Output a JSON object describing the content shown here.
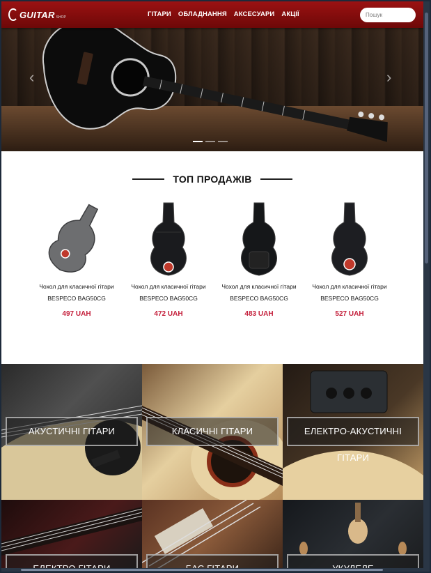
{
  "logo": {
    "text": "GUITAR",
    "sub": "SHOP"
  },
  "nav": {
    "items": [
      {
        "label": "ГІТАРИ"
      },
      {
        "label": "ОБЛАДНАННЯ"
      },
      {
        "label": "АКСЕСУАРИ"
      },
      {
        "label": "АКЦІЇ"
      }
    ]
  },
  "search": {
    "placeholder": "Пошук"
  },
  "hero": {
    "prev_icon": "chevron-left-icon",
    "next_icon": "chevron-right-icon",
    "slides": 3,
    "active_slide": 1
  },
  "top_sales": {
    "title": "ТОП ПРОДАЖІВ",
    "products": [
      {
        "name_line1": "Чохол для класичної гітари",
        "name_line2": "BESPECO BAG50CG",
        "price": "497 UAH",
        "color": "#6d6e70"
      },
      {
        "name_line1": "Чохол для класичної гітари",
        "name_line2": "BESPECO BAG50CG",
        "price": "472 UAH",
        "color": "#1a1b1e"
      },
      {
        "name_line1": "Чохол для класичної гітари",
        "name_line2": "BESPECO BAG50CG",
        "price": "483 UAH",
        "color": "#151719"
      },
      {
        "name_line1": "Чохол для класичної гітари",
        "name_line2": "BESPECO BAG50CG",
        "price": "527 UAH",
        "color": "#1d1e22"
      }
    ]
  },
  "categories": [
    {
      "label": "АКУСТИЧНІ ГІТАРИ"
    },
    {
      "label": "КЛАСИЧНІ ГІТАРИ"
    },
    {
      "label": "ЕЛЕКТРО-АКУСТИЧНІ ГІТАРИ"
    },
    {
      "label": "ЕЛЕКТРО ГІТАРИ"
    },
    {
      "label": "БАС ГІТАРИ"
    },
    {
      "label": "УКУЛЕЛЕ"
    }
  ],
  "colors": {
    "nav_bg": "#8b0e0e",
    "price": "#c41e3a"
  }
}
